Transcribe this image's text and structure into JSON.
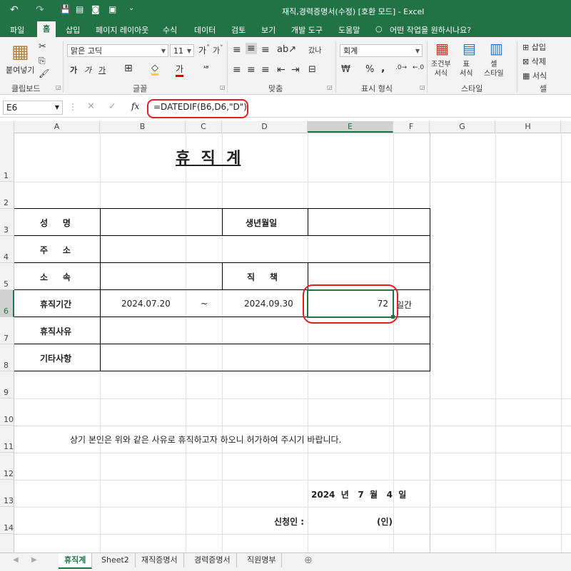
{
  "window": {
    "title": "재직,경력증명서(수정)  [호환 모드]  -  Excel"
  },
  "quick_access": {
    "undo_icon": "↶",
    "redo_icon": "↷",
    "save_icon": "💾"
  },
  "tabs": [
    "파일",
    "홈",
    "삽입",
    "페이지 레이아웃",
    "수식",
    "데이터",
    "검토",
    "보기",
    "개발 도구",
    "도움말"
  ],
  "tell_me": "어떤 작업을 원하시나요?",
  "ribbon": {
    "clipboard": {
      "paste": "붙여넣기",
      "label": "클립보드"
    },
    "font": {
      "name": "맑은 고딕",
      "size": "11",
      "label": "글꼴",
      "bold": "가",
      "italic": "가",
      "underline": "가"
    },
    "align": {
      "label": "맞춤",
      "wrap": "갔나",
      "merge": "병합"
    },
    "number": {
      "format": "회계",
      "label": "표시 형식",
      "percent": "%",
      "comma": ","
    },
    "styles": {
      "cond": "조건부\n서식",
      "table": "표\n서식",
      "cell": "셀\n스타일",
      "label": "스타일"
    },
    "cells": {
      "insert": "삽입",
      "delete": "삭제",
      "format": "서식",
      "label": "셀"
    }
  },
  "formula_bar": {
    "name_box": "E6",
    "formula": "=DATEDIF(B6,D6,\"D\")",
    "fx": "fx"
  },
  "columns": [
    "A",
    "B",
    "C",
    "D",
    "E",
    "F",
    "G",
    "H"
  ],
  "rows": [
    "1",
    "2",
    "3",
    "4",
    "5",
    "6",
    "7",
    "8",
    "9",
    "10",
    "11",
    "12",
    "13",
    "14"
  ],
  "sheet": {
    "title": "휴  직  계",
    "labels": {
      "name": "성     명",
      "birth": "생년월일",
      "address": "주     소",
      "dept": "소     속",
      "position": "직     책",
      "period": "휴직기간",
      "reason": "휴직사유",
      "other": "기타사항"
    },
    "period_start": "2024.07.20",
    "tilde": "~",
    "period_end": "2024.09.30",
    "days": "72",
    "days_unit": "일간",
    "statement": "상기 본인은 위와 같은 사유로 휴직하고자 하오니 허가하여 주시기 바랍니다.",
    "date_line": "2024  년   7  월   4  일",
    "applicant": "신청인 :",
    "seal": "(인)"
  },
  "sheet_tabs": [
    "휴직계",
    "Sheet2",
    "재직증명서",
    "경력증명서",
    "직원명부"
  ],
  "colors": {
    "excel_green": "#217346",
    "highlight_red": "#e02020"
  }
}
